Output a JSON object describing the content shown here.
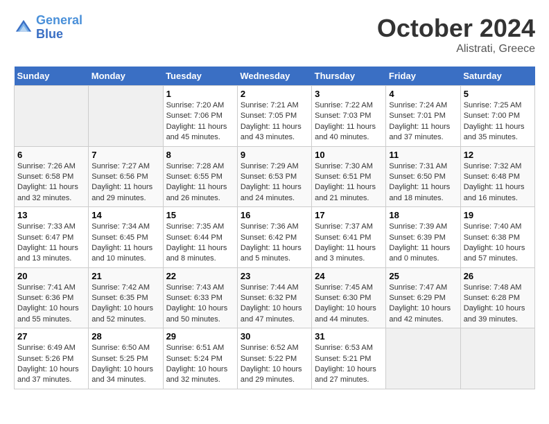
{
  "header": {
    "logo_line1": "General",
    "logo_line2": "Blue",
    "month": "October 2024",
    "location": "Alistrati, Greece"
  },
  "days_of_week": [
    "Sunday",
    "Monday",
    "Tuesday",
    "Wednesday",
    "Thursday",
    "Friday",
    "Saturday"
  ],
  "weeks": [
    [
      {
        "day": "",
        "empty": true
      },
      {
        "day": "",
        "empty": true
      },
      {
        "day": "1",
        "sunrise": "7:20 AM",
        "sunset": "7:06 PM",
        "daylight": "11 hours and 45 minutes."
      },
      {
        "day": "2",
        "sunrise": "7:21 AM",
        "sunset": "7:05 PM",
        "daylight": "11 hours and 43 minutes."
      },
      {
        "day": "3",
        "sunrise": "7:22 AM",
        "sunset": "7:03 PM",
        "daylight": "11 hours and 40 minutes."
      },
      {
        "day": "4",
        "sunrise": "7:24 AM",
        "sunset": "7:01 PM",
        "daylight": "11 hours and 37 minutes."
      },
      {
        "day": "5",
        "sunrise": "7:25 AM",
        "sunset": "7:00 PM",
        "daylight": "11 hours and 35 minutes."
      }
    ],
    [
      {
        "day": "6",
        "sunrise": "7:26 AM",
        "sunset": "6:58 PM",
        "daylight": "11 hours and 32 minutes."
      },
      {
        "day": "7",
        "sunrise": "7:27 AM",
        "sunset": "6:56 PM",
        "daylight": "11 hours and 29 minutes."
      },
      {
        "day": "8",
        "sunrise": "7:28 AM",
        "sunset": "6:55 PM",
        "daylight": "11 hours and 26 minutes."
      },
      {
        "day": "9",
        "sunrise": "7:29 AM",
        "sunset": "6:53 PM",
        "daylight": "11 hours and 24 minutes."
      },
      {
        "day": "10",
        "sunrise": "7:30 AM",
        "sunset": "6:51 PM",
        "daylight": "11 hours and 21 minutes."
      },
      {
        "day": "11",
        "sunrise": "7:31 AM",
        "sunset": "6:50 PM",
        "daylight": "11 hours and 18 minutes."
      },
      {
        "day": "12",
        "sunrise": "7:32 AM",
        "sunset": "6:48 PM",
        "daylight": "11 hours and 16 minutes."
      }
    ],
    [
      {
        "day": "13",
        "sunrise": "7:33 AM",
        "sunset": "6:47 PM",
        "daylight": "11 hours and 13 minutes."
      },
      {
        "day": "14",
        "sunrise": "7:34 AM",
        "sunset": "6:45 PM",
        "daylight": "11 hours and 10 minutes."
      },
      {
        "day": "15",
        "sunrise": "7:35 AM",
        "sunset": "6:44 PM",
        "daylight": "11 hours and 8 minutes."
      },
      {
        "day": "16",
        "sunrise": "7:36 AM",
        "sunset": "6:42 PM",
        "daylight": "11 hours and 5 minutes."
      },
      {
        "day": "17",
        "sunrise": "7:37 AM",
        "sunset": "6:41 PM",
        "daylight": "11 hours and 3 minutes."
      },
      {
        "day": "18",
        "sunrise": "7:39 AM",
        "sunset": "6:39 PM",
        "daylight": "11 hours and 0 minutes."
      },
      {
        "day": "19",
        "sunrise": "7:40 AM",
        "sunset": "6:38 PM",
        "daylight": "10 hours and 57 minutes."
      }
    ],
    [
      {
        "day": "20",
        "sunrise": "7:41 AM",
        "sunset": "6:36 PM",
        "daylight": "10 hours and 55 minutes."
      },
      {
        "day": "21",
        "sunrise": "7:42 AM",
        "sunset": "6:35 PM",
        "daylight": "10 hours and 52 minutes."
      },
      {
        "day": "22",
        "sunrise": "7:43 AM",
        "sunset": "6:33 PM",
        "daylight": "10 hours and 50 minutes."
      },
      {
        "day": "23",
        "sunrise": "7:44 AM",
        "sunset": "6:32 PM",
        "daylight": "10 hours and 47 minutes."
      },
      {
        "day": "24",
        "sunrise": "7:45 AM",
        "sunset": "6:30 PM",
        "daylight": "10 hours and 44 minutes."
      },
      {
        "day": "25",
        "sunrise": "7:47 AM",
        "sunset": "6:29 PM",
        "daylight": "10 hours and 42 minutes."
      },
      {
        "day": "26",
        "sunrise": "7:48 AM",
        "sunset": "6:28 PM",
        "daylight": "10 hours and 39 minutes."
      }
    ],
    [
      {
        "day": "27",
        "sunrise": "6:49 AM",
        "sunset": "5:26 PM",
        "daylight": "10 hours and 37 minutes."
      },
      {
        "day": "28",
        "sunrise": "6:50 AM",
        "sunset": "5:25 PM",
        "daylight": "10 hours and 34 minutes."
      },
      {
        "day": "29",
        "sunrise": "6:51 AM",
        "sunset": "5:24 PM",
        "daylight": "10 hours and 32 minutes."
      },
      {
        "day": "30",
        "sunrise": "6:52 AM",
        "sunset": "5:22 PM",
        "daylight": "10 hours and 29 minutes."
      },
      {
        "day": "31",
        "sunrise": "6:53 AM",
        "sunset": "5:21 PM",
        "daylight": "10 hours and 27 minutes."
      },
      {
        "day": "",
        "empty": true
      },
      {
        "day": "",
        "empty": true
      }
    ]
  ],
  "labels": {
    "sunrise": "Sunrise:",
    "sunset": "Sunset:",
    "daylight": "Daylight:"
  }
}
